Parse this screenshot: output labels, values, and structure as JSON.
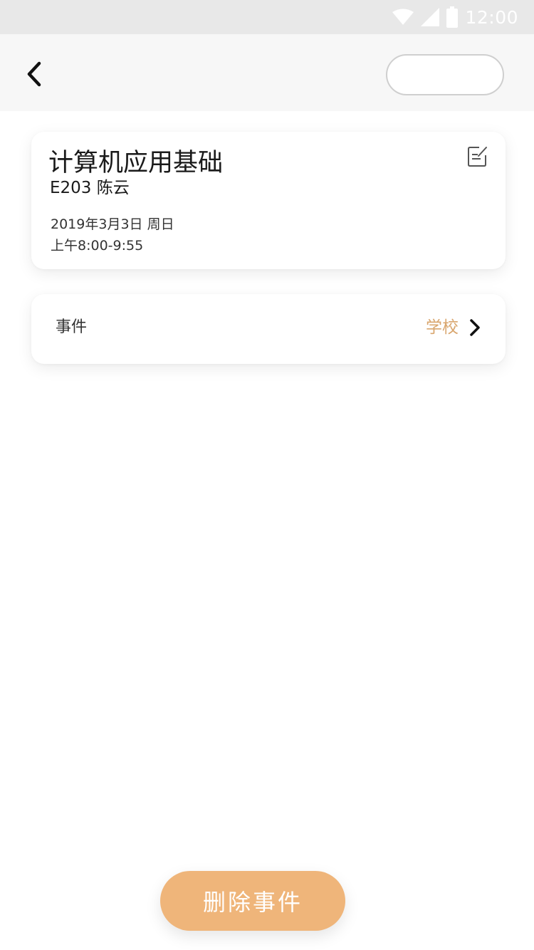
{
  "status_bar": {
    "time": "12:00",
    "icons": [
      "wifi-icon",
      "cellular-signal-icon",
      "battery-icon"
    ]
  },
  "nav": {
    "back_icon": "chevron-left-icon",
    "pill_label": ""
  },
  "course": {
    "title": "计算机应用基础",
    "room_teacher": "E203 陈云",
    "date": "2019年3月3日 周日",
    "time": "上午8:00-9:55",
    "edit_icon": "edit-note-icon"
  },
  "event": {
    "label": "事件",
    "value": "学校",
    "chevron_icon": "chevron-right-icon"
  },
  "actions": {
    "delete_label": "删除事件"
  },
  "colors": {
    "accent": "#efb57a",
    "event_value": "#d9a66e",
    "status_bar_bg": "#e8e8e8",
    "nav_bg": "#f7f7f7",
    "text_primary": "#1a1a1a"
  }
}
